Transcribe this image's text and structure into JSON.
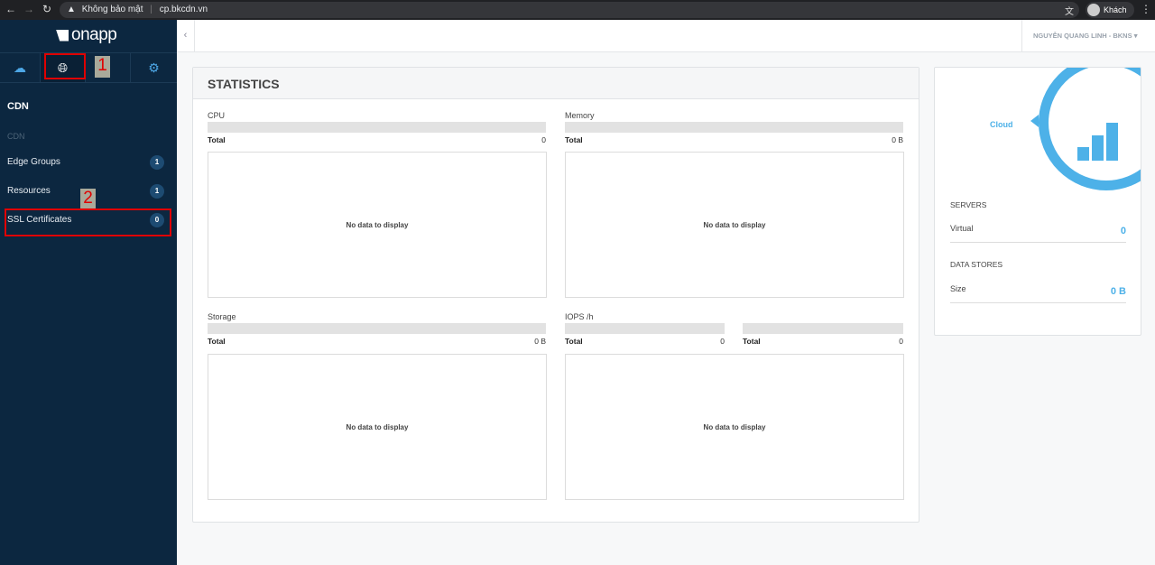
{
  "browser": {
    "security": "Không bảo mật",
    "url": "cp.bkcdn.vn",
    "profile": "Khách"
  },
  "sidebar": {
    "logo": "onapp",
    "section_title": "CDN",
    "group_label": "CDN",
    "items": [
      {
        "label": "Edge Groups",
        "count": "1"
      },
      {
        "label": "Resources",
        "count": "1"
      },
      {
        "label": "SSL Certificates",
        "count": "0"
      }
    ]
  },
  "header": {
    "user": "NGUYỄN QUANG LINH - BKNS"
  },
  "statistics": {
    "title": "STATISTICS",
    "no_data": "No data to display",
    "total_label": "Total",
    "cpu": {
      "label": "CPU",
      "total": "0"
    },
    "memory": {
      "label": "Memory",
      "total": "0 B"
    },
    "storage": {
      "label": "Storage",
      "total": "0 B"
    },
    "iops": {
      "label": "IOPS /h",
      "total1": "0",
      "total2": "0"
    }
  },
  "summary": {
    "cloud_label": "Cloud",
    "servers_title": "SERVERS",
    "virtual_label": "Virtual",
    "virtual_value": "0",
    "datastores_title": "DATA STORES",
    "size_label": "Size",
    "size_value": "0 B"
  },
  "annotations": {
    "one": "1",
    "two": "2"
  },
  "colors": {
    "accent": "#4db1e8",
    "sidebar": "#0c2740",
    "annotation": "#e00000"
  }
}
